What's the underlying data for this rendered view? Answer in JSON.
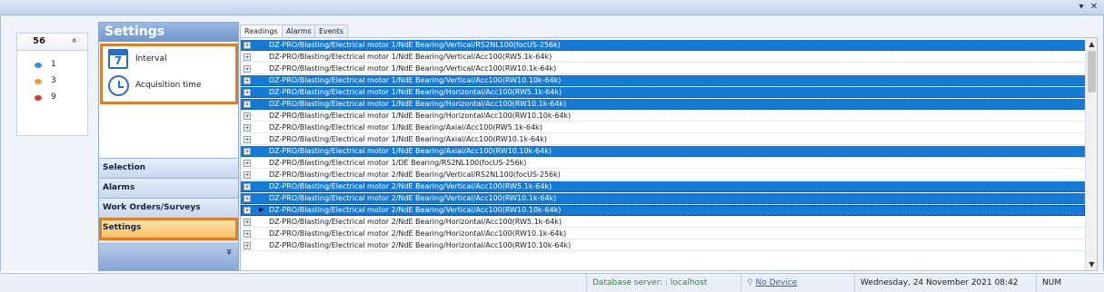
{
  "window": {
    "dropdown_glyph": "▾",
    "close_glyph": "✕"
  },
  "summary": {
    "count": "56",
    "collapse_glyph": "»",
    "statuses": [
      {
        "value": "1",
        "color": "#3a8fd6"
      },
      {
        "value": "3",
        "color": "#f09a3a"
      },
      {
        "value": "9",
        "color": "#d83a2f"
      }
    ]
  },
  "nav": {
    "title": "Settings",
    "content_items": [
      {
        "label": "Interval",
        "icon": "calendar-icon",
        "icon_text": "7"
      },
      {
        "label": "Acquisition time",
        "icon": "clock-icon"
      }
    ],
    "splitter_dots": "::::::::",
    "buttons": [
      {
        "label": "Selection",
        "active": false
      },
      {
        "label": "Alarms",
        "active": false
      },
      {
        "label": "Work Orders/Surveys",
        "active": false
      },
      {
        "label": "Settings",
        "active": true
      }
    ],
    "more_glyph": "»"
  },
  "tabs": [
    {
      "label": "Readings",
      "active": true
    },
    {
      "label": "Alarms",
      "active": false
    },
    {
      "label": "Events",
      "active": false
    }
  ],
  "grid": {
    "rows": [
      {
        "text": "DZ-PRO/Blasting/Electrical motor 1/NdE Bearing/Vertical/RS2NL100(focUS-256k)",
        "selected": true
      },
      {
        "text": "DZ-PRO/Blasting/Electrical motor 1/NdE Bearing/Vertical/Acc100(RW5.1k-64k)",
        "selected": false
      },
      {
        "text": "DZ-PRO/Blasting/Electrical motor 1/NdE Bearing/Vertical/Acc100(RW10.1k-64k)",
        "selected": false
      },
      {
        "text": "DZ-PRO/Blasting/Electrical motor 1/NdE Bearing/Vertical/Acc100(RW10.10k-64k)",
        "selected": true
      },
      {
        "text": "DZ-PRO/Blasting/Electrical motor 1/NdE Bearing/Horizontal/Acc100(RW5.1k-64k)",
        "selected": true
      },
      {
        "text": "DZ-PRO/Blasting/Electrical motor 1/NdE Bearing/Horizontal/Acc100(RW10.1k-64k)",
        "selected": true
      },
      {
        "text": "DZ-PRO/Blasting/Electrical motor 1/NdE Bearing/Horizontal/Acc100(RW10.10k-64k)",
        "selected": false
      },
      {
        "text": "DZ-PRO/Blasting/Electrical motor 1/NdE Bearing/Axial/Acc100(RW5.1k-64k)",
        "selected": false
      },
      {
        "text": "DZ-PRO/Blasting/Electrical motor 1/NdE Bearing/Axial/Acc100(RW10.1k-64k)",
        "selected": false
      },
      {
        "text": "DZ-PRO/Blasting/Electrical motor 1/NdE Bearing/Axial/Acc100(RW10.10k-64k)",
        "selected": true
      },
      {
        "text": "DZ-PRO/Blasting/Electrical motor 1/DE Bearing/RS2NL100(focUS-256k)",
        "selected": false
      },
      {
        "text": "DZ-PRO/Blasting/Electrical motor 2/NdE Bearing/Vertical/RS2NL100(focUS-256k)",
        "selected": false
      },
      {
        "text": "DZ-PRO/Blasting/Electrical motor 2/NdE Bearing/Vertical/Acc100(RW5.1k-64k)",
        "selected": true
      },
      {
        "text": "DZ-PRO/Blasting/Electrical motor 2/NdE Bearing/Vertical/Acc100(RW10.1k-64k)",
        "selected": true
      },
      {
        "text": "DZ-PRO/Blasting/Electrical motor 2/NdE Bearing/Vertical/Acc100(RW10.10k-64k)",
        "selected": true,
        "current": true
      },
      {
        "text": "DZ-PRO/Blasting/Electrical motor 2/NdE Bearing/Horizontal/Acc100(RW5.1k-64k)",
        "selected": false
      },
      {
        "text": "DZ-PRO/Blasting/Electrical motor 2/NdE Bearing/Horizontal/Acc100(RW10.1k-64k)",
        "selected": false
      },
      {
        "text": "DZ-PRO/Blasting/Electrical motor 2/NdE Bearing/Horizontal/Acc100(RW10.10k-64k)",
        "selected": false
      }
    ],
    "expander_glyph": "+",
    "pointer_glyph": "▶",
    "scroll_up_glyph": "▲",
    "scroll_down_glyph": "▼"
  },
  "status_bar": {
    "database": "Database server: : localhost",
    "device": "No Device",
    "device_icon": "pin-icon",
    "datetime": "Wednesday, 24 November 2021  08:42",
    "num": "NUM"
  }
}
